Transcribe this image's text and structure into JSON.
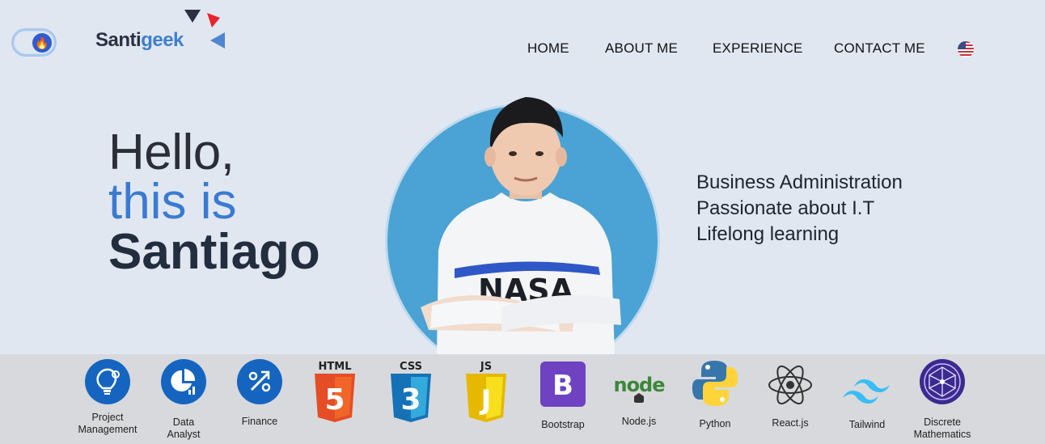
{
  "header": {
    "logo": {
      "part1": "Santi",
      "part2": "geek"
    },
    "nav": [
      {
        "label": "HOME"
      },
      {
        "label": "ABOUT ME"
      },
      {
        "label": "EXPERIENCE"
      },
      {
        "label": "CONTACT ME"
      }
    ],
    "language_flag": "us-flag-icon",
    "theme_toggle_icon": "flame-icon"
  },
  "hero": {
    "line1": "Hello,",
    "line2": "this is",
    "line3": "Santiago",
    "tagline": [
      "Business Administration",
      "Passionate about I.T",
      "Lifelong learning"
    ],
    "shirt_text": "NASA"
  },
  "skills": [
    {
      "label_l1": "Project",
      "label_l2": "Management",
      "icon": "lightbulb-gear-icon"
    },
    {
      "label_l1": "Data",
      "label_l2": "Analyst",
      "icon": "pie-chart-icon"
    },
    {
      "label_l1": "Finance",
      "label_l2": "",
      "icon": "percent-icon"
    },
    {
      "label_l1": "",
      "label_l2": "",
      "icon": "html5-icon",
      "badge": "HTML",
      "glyph": "5"
    },
    {
      "label_l1": "",
      "label_l2": "",
      "icon": "css3-icon",
      "badge": "CSS",
      "glyph": "3"
    },
    {
      "label_l1": "",
      "label_l2": "",
      "icon": "js-icon",
      "badge": "JS",
      "glyph": "J"
    },
    {
      "label_l1": "Bootstrap",
      "label_l2": "",
      "icon": "bootstrap-icon",
      "glyph": "B"
    },
    {
      "label_l1": "Node.js",
      "label_l2": "",
      "icon": "nodejs-icon",
      "glyph": "node"
    },
    {
      "label_l1": "Python",
      "label_l2": "",
      "icon": "python-icon"
    },
    {
      "label_l1": "React.js",
      "label_l2": "",
      "icon": "react-icon"
    },
    {
      "label_l1": "Tailwind",
      "label_l2": "",
      "icon": "tailwind-icon"
    },
    {
      "label_l1": "Discrete",
      "label_l2": "Mathematics",
      "icon": "network-icon"
    }
  ],
  "colors": {
    "background": "#e1e7f1",
    "skills_bar": "#d8d9dc",
    "accent_blue": "#3a7bd1",
    "name_dark": "#222d3e",
    "portrait_circle": "#4aa3d4"
  }
}
